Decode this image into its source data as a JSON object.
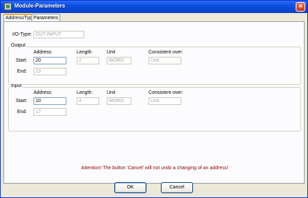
{
  "window": {
    "title": "Module-Parameters",
    "close_label": "×"
  },
  "tabs": [
    {
      "label": "Address/Type",
      "active": true
    },
    {
      "label": "Parameters",
      "active": false
    }
  ],
  "io_type": {
    "label": "I/O-Type:",
    "value": "OUT-INPUT"
  },
  "output": {
    "legend": "Output",
    "col_address": "Address:",
    "col_length": "Length:",
    "col_unit": "Unit",
    "col_consistent": "Consistent over:",
    "start_label": "Start:",
    "end_label": "End:",
    "start_address": "20",
    "length": "2",
    "unit": "WORD",
    "consistent": "Unit",
    "end_address": "23"
  },
  "input": {
    "legend": "Input",
    "col_address": "Address:",
    "col_length": "Length:",
    "col_unit": "Unit",
    "col_consistent": "Consistent over:",
    "start_label": "Start:",
    "end_label": "End:",
    "start_address": "10",
    "length": "4",
    "unit": "WORD",
    "consistent": "Unit",
    "end_address": "17"
  },
  "attention": "Attention! The button 'Cancel' will not undo a changing of an address!",
  "buttons": {
    "ok": "OK",
    "cancel": "Cancel"
  },
  "colors": {
    "titlebar": "#0A50E0",
    "attention": "#8B0000",
    "dialog_bg": "#ECE9D8"
  }
}
